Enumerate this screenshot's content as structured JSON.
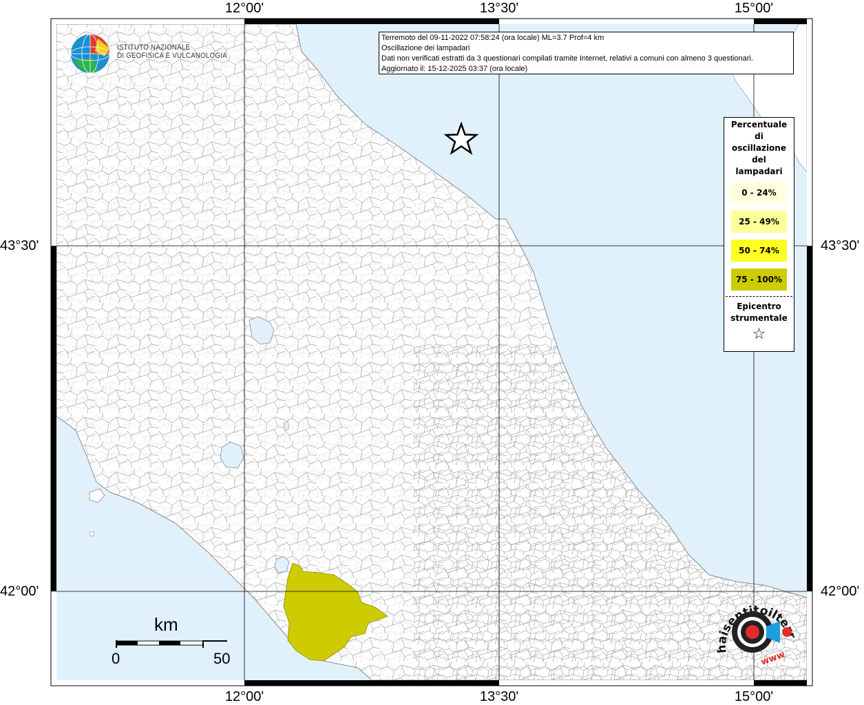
{
  "axes": {
    "lon_labels": [
      "12°00'",
      "13°30'",
      "15°00'"
    ],
    "lat_labels": [
      "43°30'",
      "42°00'"
    ]
  },
  "info": {
    "line1": "Terremoto del 09-11-2022 07:58:24 (ora locale) ML=3.7 Prof=4 km",
    "line2": "Oscillazione dei lampadari",
    "line3": "Dati non verificati estratti da 3 questionari compilati tramite Internet, relativi a comuni con almeno 3 questionari.",
    "line4": "Aggiornato il: 15-12-2025 03:37 (ora locale)"
  },
  "legend": {
    "title_lines": [
      "Percentuale",
      "di",
      "oscillazione",
      "del",
      "lampadari"
    ],
    "classes": [
      {
        "label": "0 - 24%",
        "color": "#ffffdd"
      },
      {
        "label": "25 - 49%",
        "color": "#ffff99"
      },
      {
        "label": "50 - 74%",
        "color": "#ffff22"
      },
      {
        "label": "75 - 100%",
        "color": "#cccc00"
      }
    ],
    "epicenter_lines": [
      "Epicentro",
      "strumentale"
    ]
  },
  "logo": {
    "line1": "ISTITUTO NAZIONALE",
    "line2": "DI GEOFISICA E VULCANOLOGIA"
  },
  "scalebar": {
    "unit": "km",
    "min": "0",
    "max": "50"
  },
  "sentito": {
    "text": "haisentitoilterremoto.it",
    "www": "www"
  },
  "colors": {
    "sea": "#e0f1fc",
    "land": "#ffffff",
    "highlight": "#cccc00",
    "border": "#9a9a9a"
  }
}
